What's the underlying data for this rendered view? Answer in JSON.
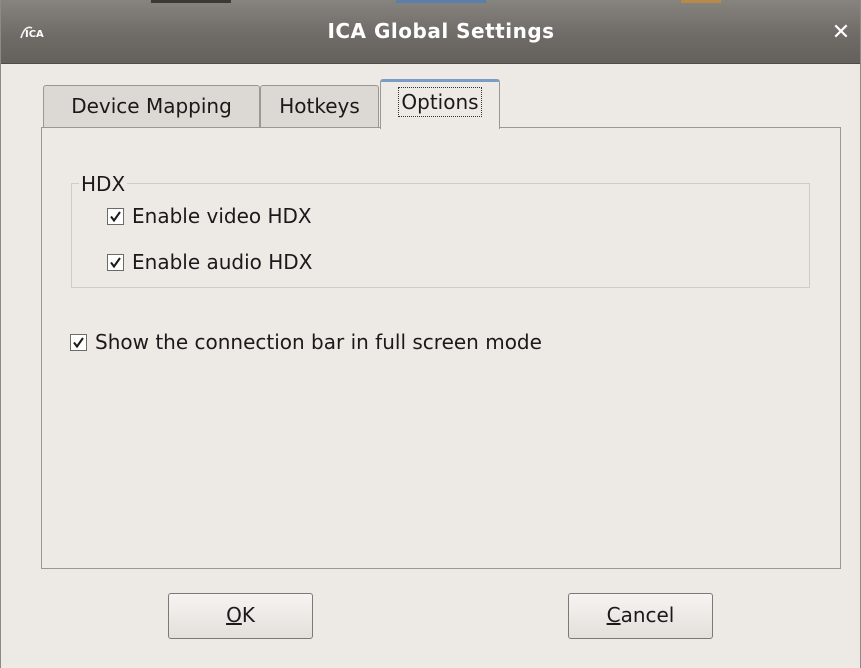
{
  "window": {
    "title": "ICA Global Settings",
    "app_icon": "ica-icon",
    "close_icon": "close-icon",
    "close_glyph": "✕"
  },
  "tabs": [
    {
      "label": "Device Mapping",
      "selected": false
    },
    {
      "label": "Hotkeys",
      "selected": false
    },
    {
      "label": "Options",
      "selected": true
    }
  ],
  "options": {
    "hdx_group": {
      "title": "HDX",
      "items": [
        {
          "label": "Enable video HDX",
          "checked": true
        },
        {
          "label": "Enable audio HDX",
          "checked": true
        }
      ]
    },
    "connection_bar": {
      "label": "Show the connection bar in full screen mode",
      "checked": true
    }
  },
  "buttons": {
    "ok": {
      "mnemonic": "O",
      "rest": "K"
    },
    "cancel": {
      "mnemonic": "C",
      "rest": "ancel"
    }
  },
  "colors": {
    "titlebar": "#6f6c68",
    "window_bg": "#edeae6",
    "tab_selected_accent": "#7a9cc8"
  }
}
